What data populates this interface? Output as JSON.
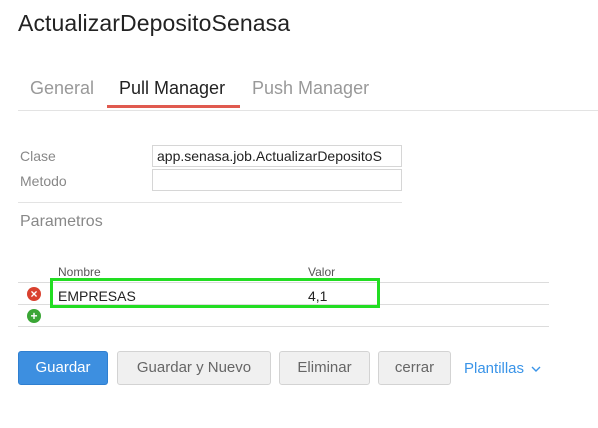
{
  "page": {
    "title": "ActualizarDepositoSenasa"
  },
  "tabs": [
    {
      "label": "General"
    },
    {
      "label": "Pull Manager"
    },
    {
      "label": "Push Manager"
    }
  ],
  "form": {
    "clase_label": "Clase",
    "clase_value": "app.senasa.job.ActualizarDepositoS",
    "metodo_label": "Metodo",
    "metodo_value": ""
  },
  "parametros": {
    "title": "Parametros",
    "headers": {
      "nombre": "Nombre",
      "valor": "Valor"
    },
    "rows": [
      {
        "nombre": "EMPRESAS",
        "valor": "4,1"
      }
    ]
  },
  "icons": {
    "remove": "remove-icon",
    "add": "add-icon",
    "chevron": "chevron-down-icon"
  },
  "colors": {
    "primary": "#3d8fe0",
    "highlight": "#22dd22",
    "remove": "#d9412f",
    "add": "#3aa635",
    "tab_active": "#e05a4f"
  },
  "buttons": {
    "guardar": "Guardar",
    "guardar_nuevo": "Guardar y Nuevo",
    "eliminar": "Eliminar",
    "cerrar": "cerrar",
    "plantillas": "Plantillas"
  }
}
